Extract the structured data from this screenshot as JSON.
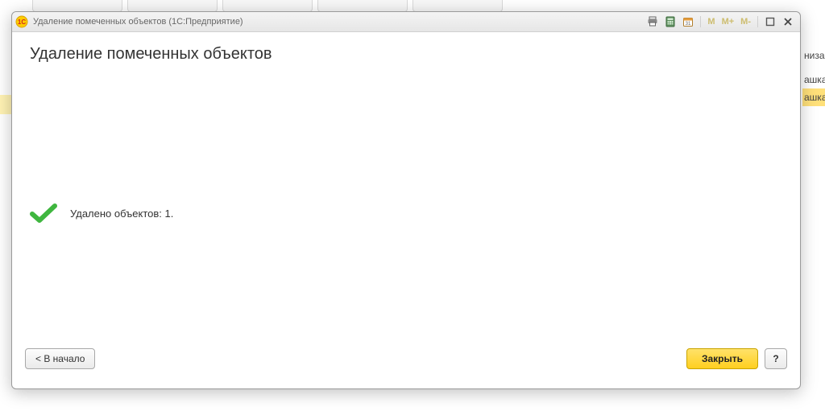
{
  "window": {
    "title": "Удаление помеченных объектов (1С:Предприятие)",
    "memory_buttons": [
      "M",
      "M+",
      "M-"
    ]
  },
  "page": {
    "heading": "Удаление помеченных объектов"
  },
  "result": {
    "message": "Удалено объектов: 1."
  },
  "footer": {
    "back_label": "< В начало",
    "close_label": "Закрыть",
    "help_label": "?"
  },
  "background": {
    "right_rows": [
      "низа",
      "ашка",
      "ашка"
    ]
  }
}
